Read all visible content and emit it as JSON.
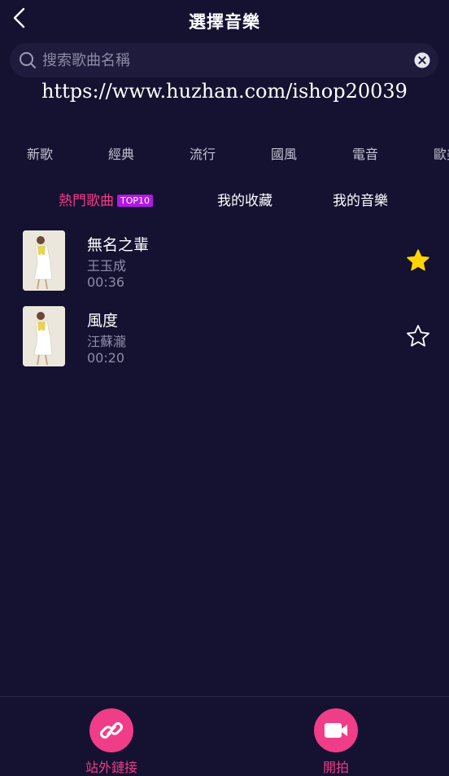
{
  "header": {
    "title": "選擇音樂",
    "back_icon": "chevron-left-icon"
  },
  "search": {
    "placeholder": "搜索歌曲名稱",
    "value": "",
    "search_icon": "search-icon",
    "clear_icon": "clear-circle-icon"
  },
  "watermark": {
    "text": "https://www.huzhan.com/ishop20039"
  },
  "categories": [
    "新歌",
    "經典",
    "流行",
    "國風",
    "電音",
    "歐美"
  ],
  "tabs": {
    "hot": {
      "label": "熱門歌曲",
      "badge": "TOP10"
    },
    "favorites": {
      "label": "我的收藏"
    },
    "mine": {
      "label": "我的音樂"
    }
  },
  "songs": [
    {
      "title": "無名之輩",
      "artist": "王玉成",
      "duration": "00:36",
      "favorited": true
    },
    {
      "title": "風度",
      "artist": "汪蘇瀧",
      "duration": "00:20",
      "favorited": false
    }
  ],
  "bottom_bar": {
    "link": {
      "label": "站外鏈接",
      "icon": "link-icon"
    },
    "shoot": {
      "label": "開拍",
      "icon": "video-camera-icon"
    }
  },
  "colors": {
    "background": "#151131",
    "accent_pink": "#f03d88",
    "badge_purple": "#b019e4",
    "star_yellow": "#ffd400",
    "muted_text": "#8f8ca6"
  }
}
